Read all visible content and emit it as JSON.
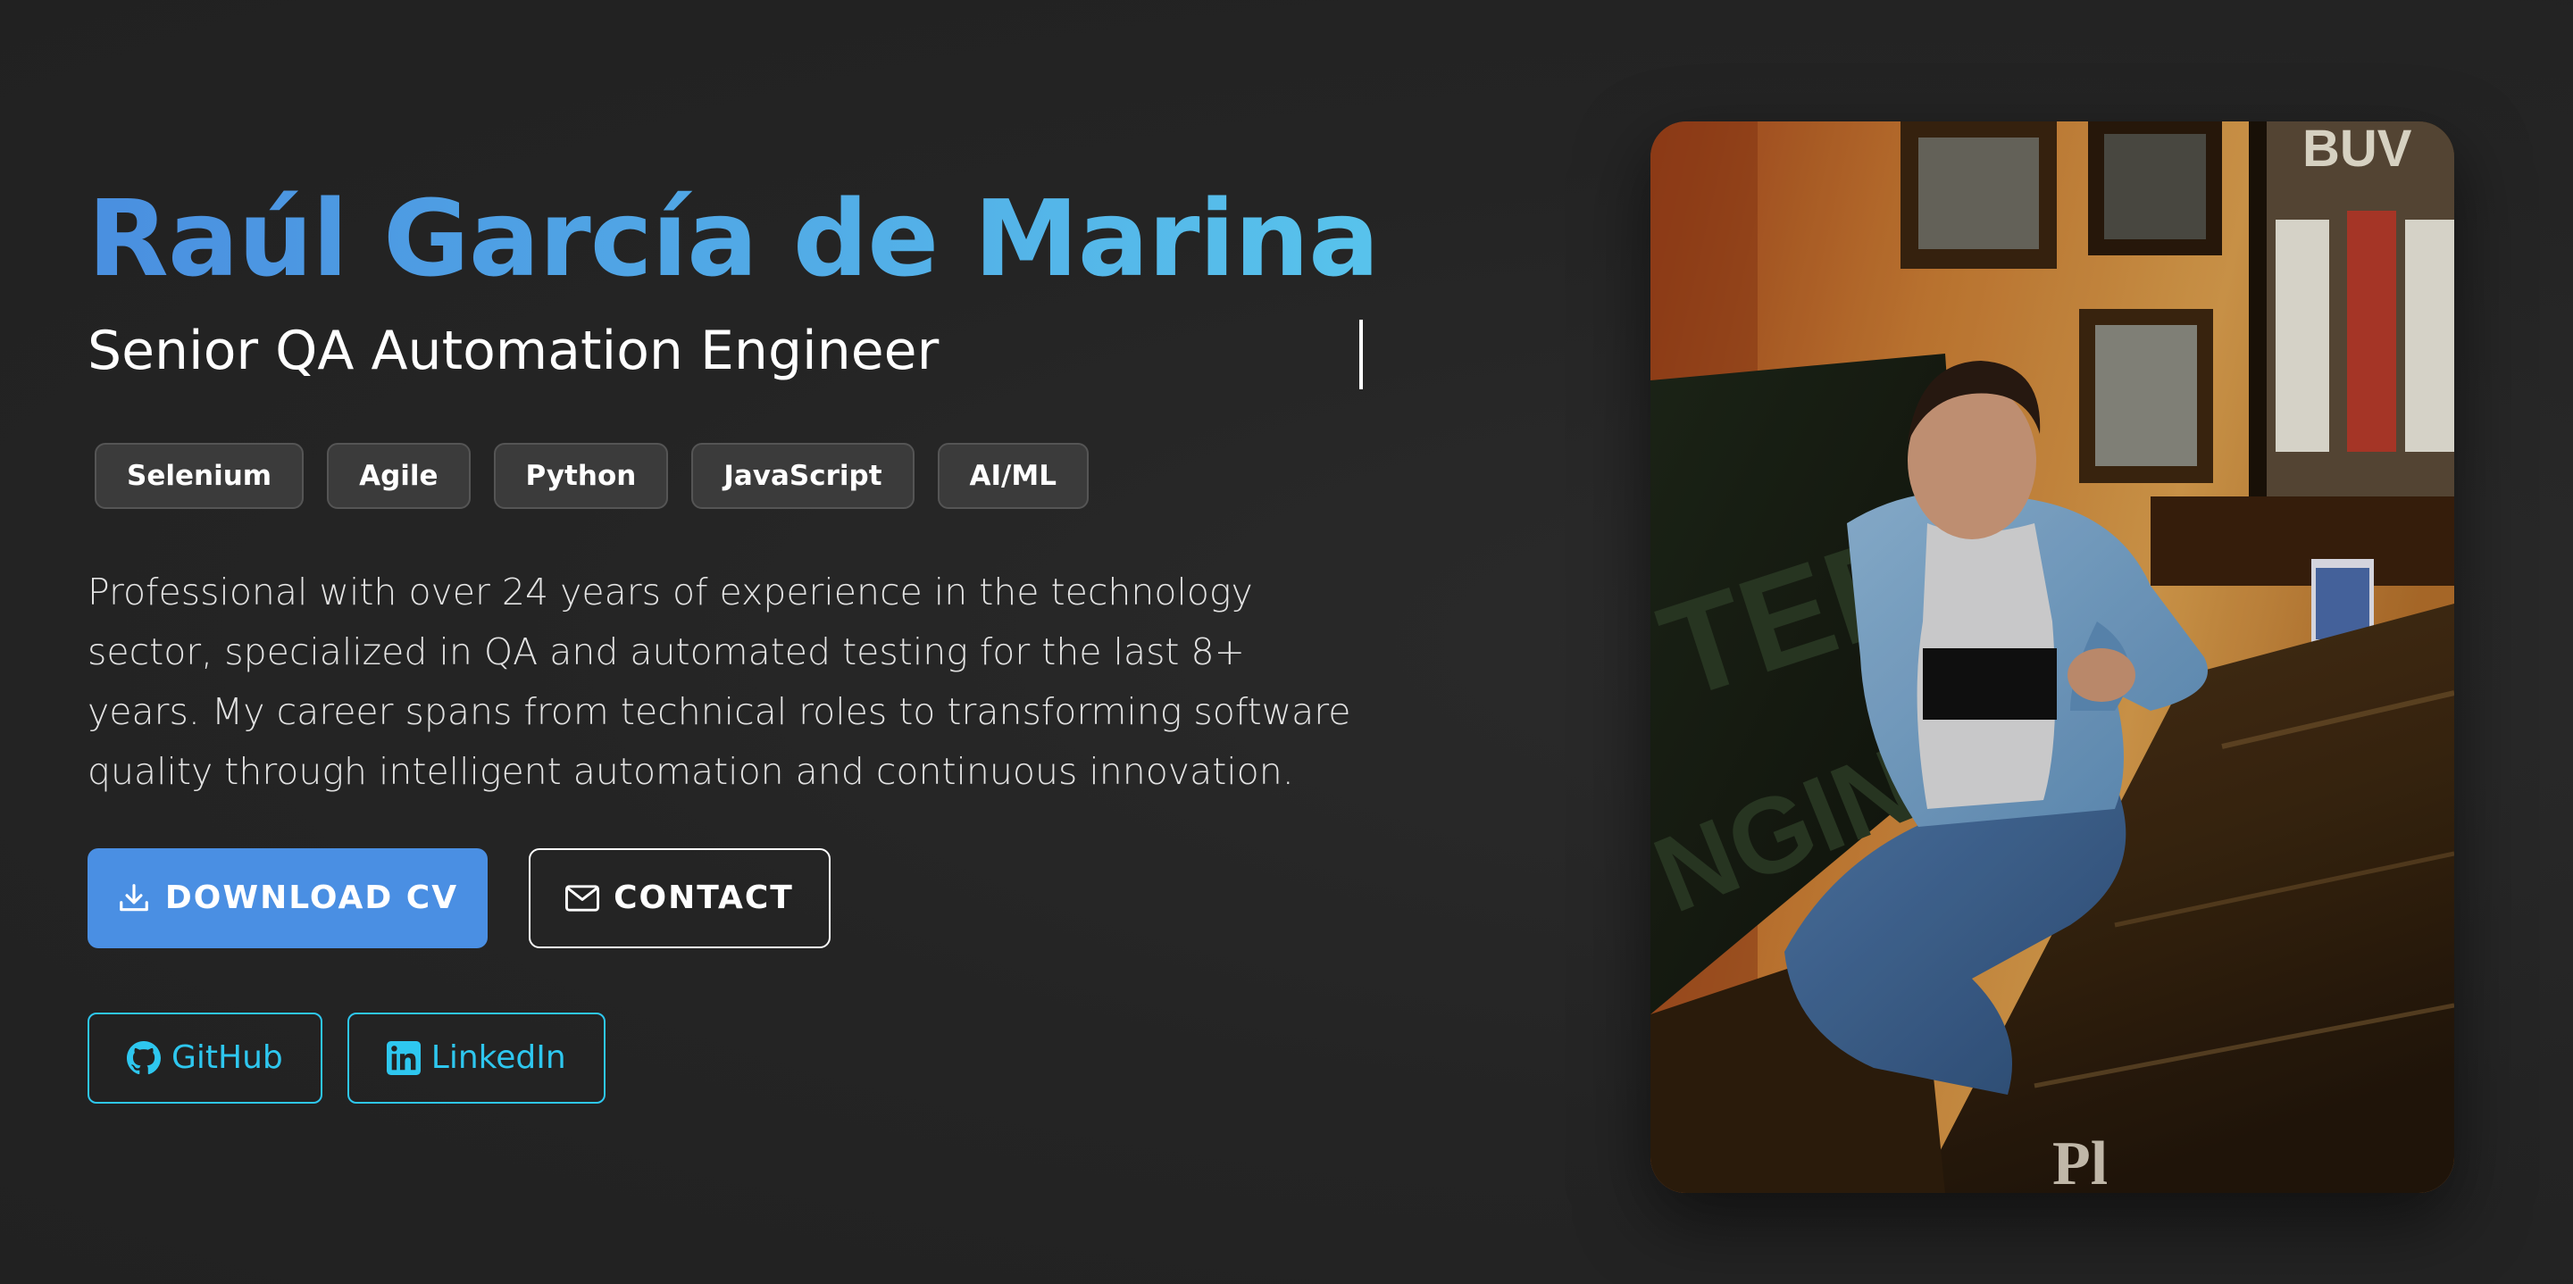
{
  "hero": {
    "name": "Raúl García de Marina",
    "subtitle": "Senior QA Automation Engineer",
    "tags": [
      "Selenium",
      "Agile",
      "Python",
      "JavaScript",
      "AI/ML"
    ],
    "bio": "Professional with over 24 years of experience in the technology sector, specialized in QA and automated testing for the last 8+ years. My career spans from technical roles to transforming software quality through intelligent automation and continuous innovation."
  },
  "buttons": {
    "download_label": "DOWNLOAD CV",
    "download_icon": "download-icon",
    "contact_label": "CONTACT",
    "contact_icon": "envelope-icon"
  },
  "socials": {
    "github_label": "GitHub",
    "github_icon": "github-icon",
    "linkedin_label": "LinkedIn",
    "linkedin_icon": "linkedin-icon"
  },
  "colors": {
    "accent_blue": "#4a8fe3",
    "accent_cyan": "#2ec7ef",
    "background": "#252525"
  },
  "photo": {
    "description": "portrait photo"
  }
}
